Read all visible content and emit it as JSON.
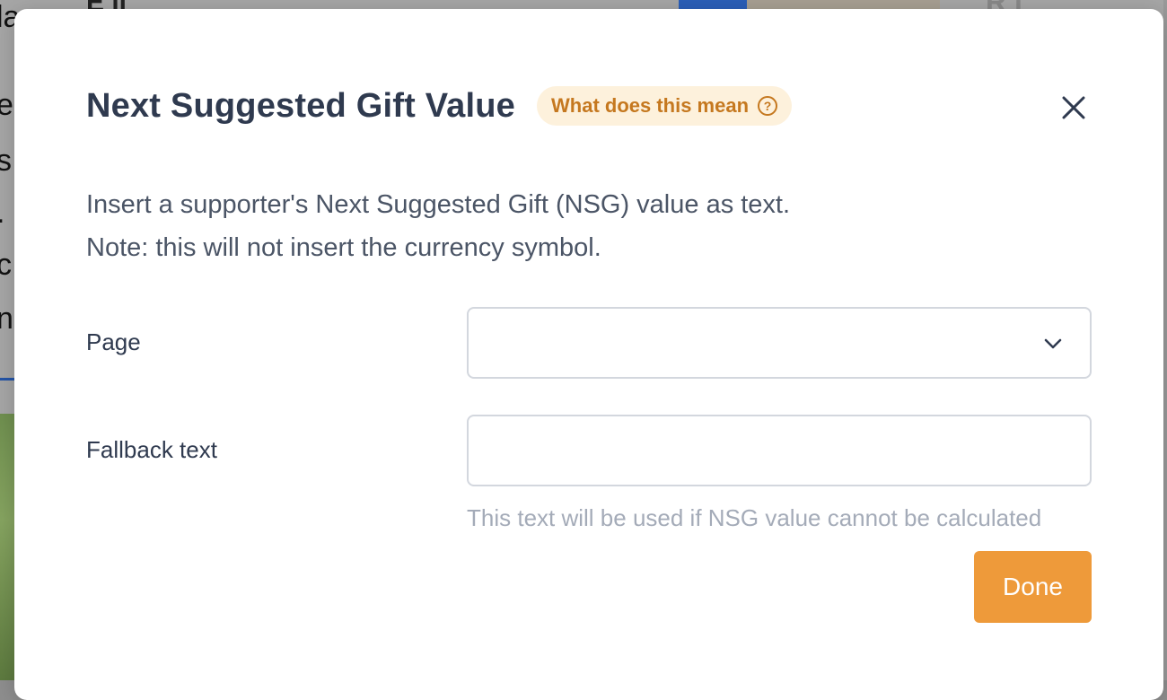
{
  "modal": {
    "title": "Next Suggested Gift Value",
    "help_label": "What does this mean",
    "help_icon": "question-circle-icon",
    "close_icon": "close-icon",
    "description": [
      "Insert a supporter's Next Suggested Gift (NSG) value as text.",
      "Note: this will not insert the currency symbol."
    ],
    "fields": {
      "page": {
        "label": "Page",
        "value": ""
      },
      "fallback": {
        "label": "Fallback text",
        "value": "",
        "placeholder": "",
        "hint": "This text will be used if NSG value cannot be calculated"
      }
    },
    "done_label": "Done"
  },
  "colors": {
    "title": "#2f3a4f",
    "help_pill_bg": "#fdf1dc",
    "help_pill_text": "#c5781f",
    "done_button": "#ee9a3a",
    "hint": "#a4abb8"
  }
}
